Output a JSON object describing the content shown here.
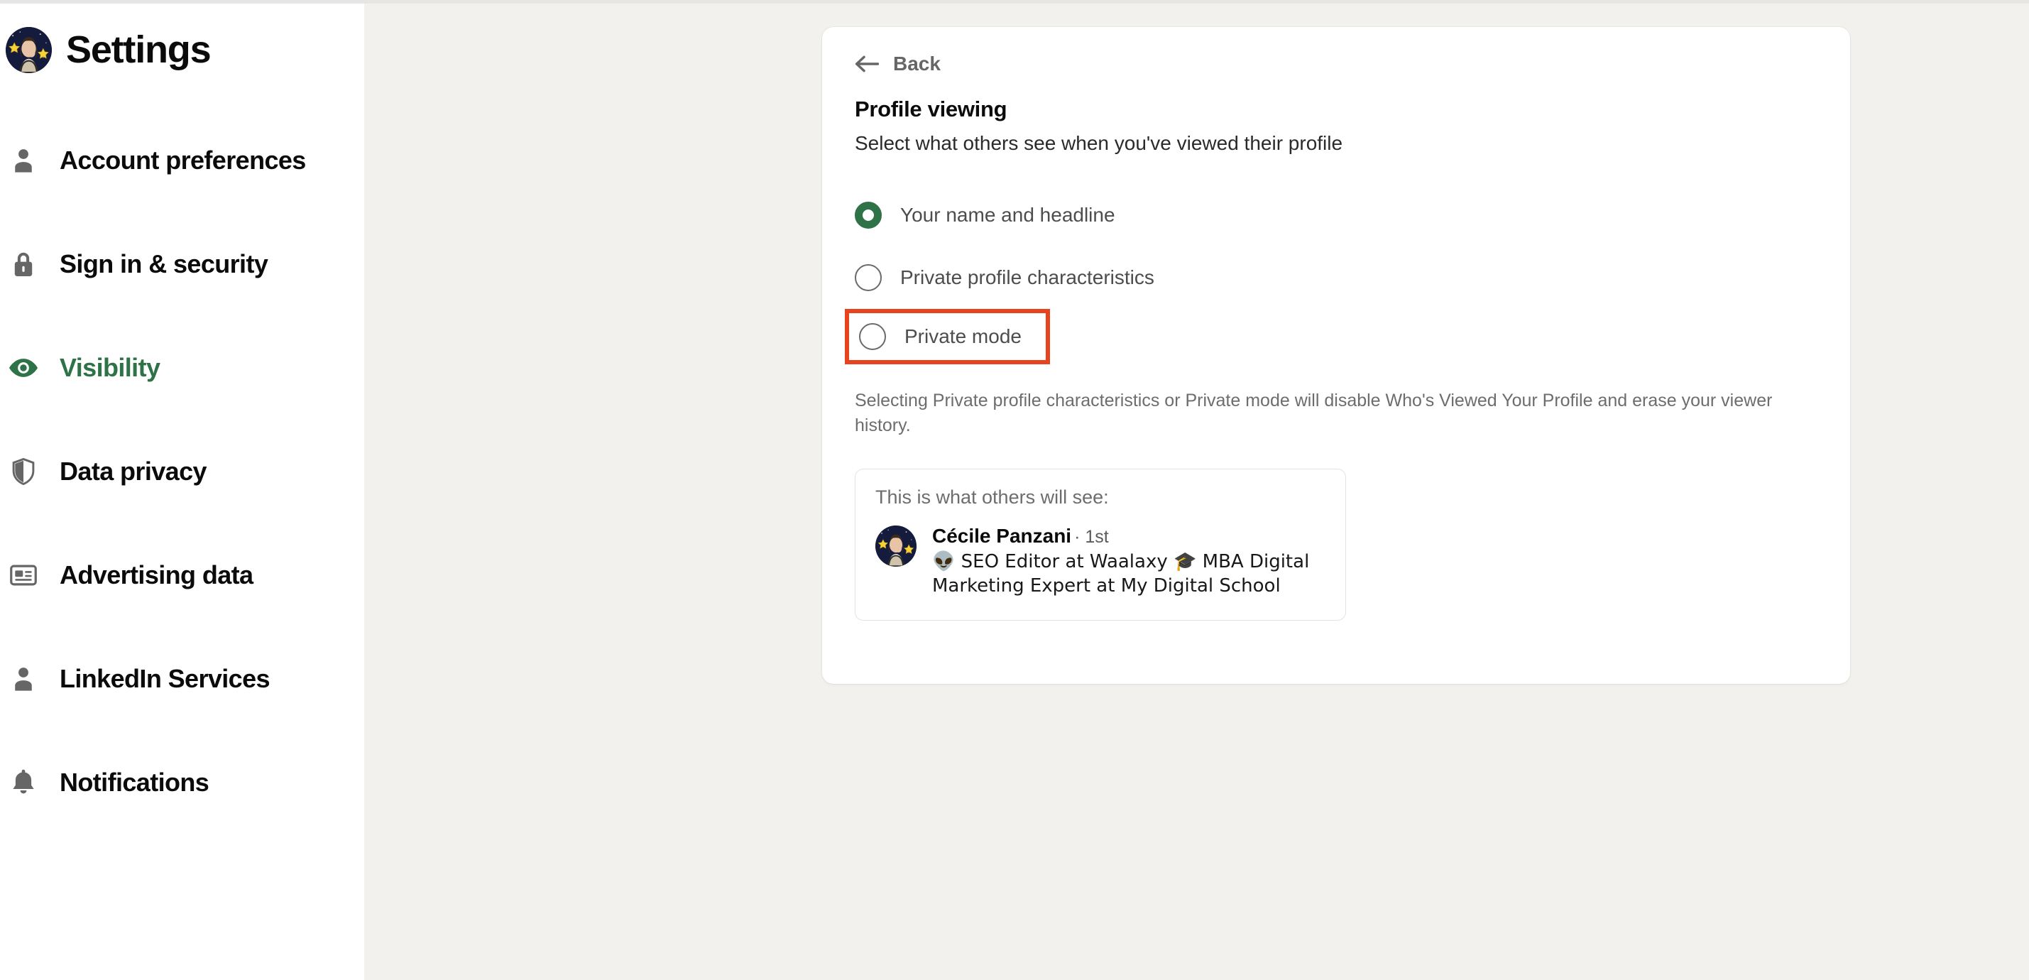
{
  "sidebar": {
    "title": "Settings",
    "avatar_name": "user-avatar",
    "items": [
      {
        "label": "Account preferences",
        "icon": "person-icon",
        "active": false
      },
      {
        "label": "Sign in & security",
        "icon": "lock-icon",
        "active": false
      },
      {
        "label": "Visibility",
        "icon": "eye-icon",
        "active": true
      },
      {
        "label": "Data privacy",
        "icon": "shield-icon",
        "active": false
      },
      {
        "label": "Advertising data",
        "icon": "card-icon",
        "active": false
      },
      {
        "label": "LinkedIn Services",
        "icon": "person-icon",
        "active": false
      },
      {
        "label": "Notifications",
        "icon": "bell-icon",
        "active": false
      }
    ]
  },
  "main": {
    "back_label": "Back",
    "title": "Profile viewing",
    "subtitle": "Select what others see when you've viewed their profile",
    "options": [
      {
        "label": "Your name and headline",
        "selected": true,
        "highlighted": false
      },
      {
        "label": "Private profile characteristics",
        "selected": false,
        "highlighted": false
      },
      {
        "label": "Private mode",
        "selected": false,
        "highlighted": true
      }
    ],
    "note": "Selecting Private profile characteristics or Private mode will disable Who's Viewed Your Profile and erase your viewer history.",
    "preview": {
      "heading": "This is what others will see:",
      "person_name": "Cécile Panzani",
      "person_degree": "· 1st",
      "person_headline": "👽 SEO Editor at Waalaxy 🎓 MBA Digital Marketing Expert at My Digital School"
    }
  },
  "colors": {
    "page_background": "#f2f1ee",
    "card_background": "#ffffff",
    "accent_green": "#2e7248",
    "highlight_red": "#e8431f",
    "muted_text": "#6d6d6d"
  }
}
